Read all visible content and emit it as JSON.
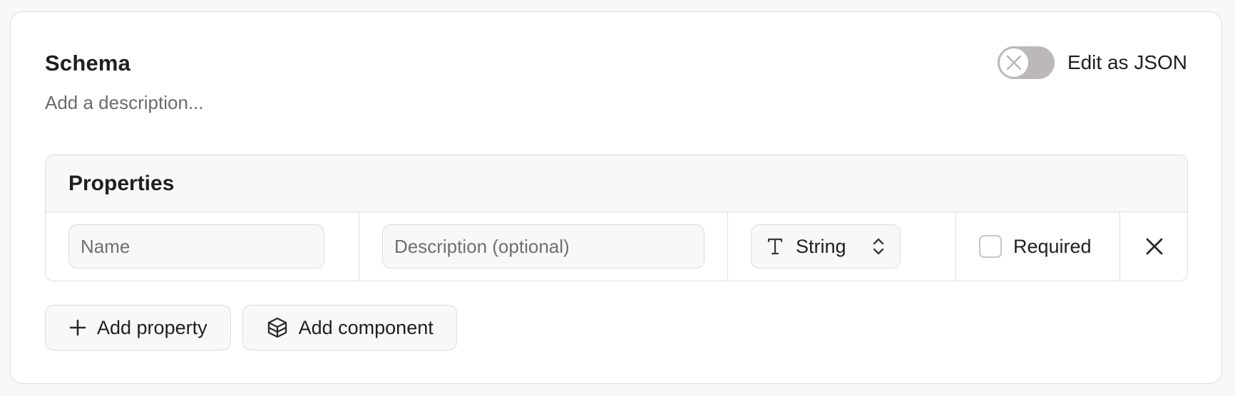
{
  "schema": {
    "title": "Schema",
    "description_placeholder": "Add a description..."
  },
  "json_toggle": {
    "label": "Edit as JSON",
    "enabled": false
  },
  "properties": {
    "heading": "Properties",
    "rows": [
      {
        "name_placeholder": "Name",
        "description_placeholder": "Description (optional)",
        "type": "String",
        "required_label": "Required",
        "required": false
      }
    ]
  },
  "actions": {
    "add_property": "Add property",
    "add_component": "Add component"
  },
  "icons": {
    "toggle_knob": "x-icon",
    "type": "text-type-icon",
    "select": "chevron-up-down-icon",
    "remove": "close-icon",
    "add_property": "plus-icon",
    "add_component": "cube-icon"
  }
}
